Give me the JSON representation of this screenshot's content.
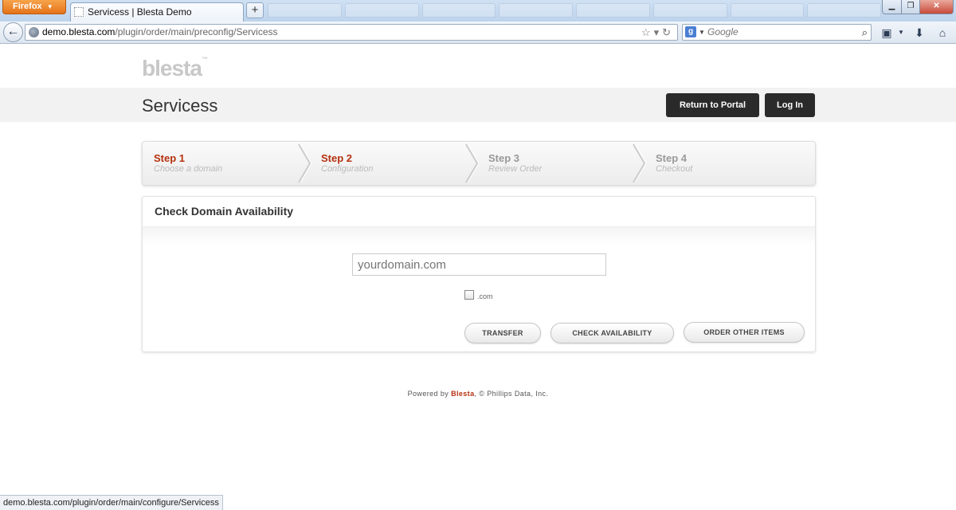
{
  "browser": {
    "menu_button": "Firefox",
    "tab_title": "Servicess | Blesta Demo",
    "new_tab": "+",
    "url_host": "demo.blesta.com",
    "url_path": "/plugin/order/main/preconfig/Servicess",
    "search_placeholder": "Google",
    "status_url": "demo.blesta.com/plugin/order/main/configure/Servicess"
  },
  "header": {
    "logo": "blesta",
    "title": "Servicess",
    "return_label": "Return to Portal",
    "login_label": "Log In"
  },
  "steps": [
    {
      "number": "Step 1",
      "label": "Choose a domain"
    },
    {
      "number": "Step 2",
      "label": "Configuration"
    },
    {
      "number": "Step 3",
      "label": "Review Order"
    },
    {
      "number": "Step 4",
      "label": "Checkout"
    }
  ],
  "panel": {
    "title": "Check Domain Availability",
    "domain_placeholder": "yourdomain.com",
    "tld": ".com",
    "transfer_label": "TRANSFER",
    "check_label": "CHECK AVAILABILITY",
    "order_label": "ORDER OTHER ITEMS"
  },
  "footer": {
    "prefix": "Powered by",
    "brand": "Blesta",
    "suffix": ", © Phillips Data, Inc."
  },
  "colors": {
    "accent": "#b5310f",
    "dark_button": "#2a2a2a"
  }
}
